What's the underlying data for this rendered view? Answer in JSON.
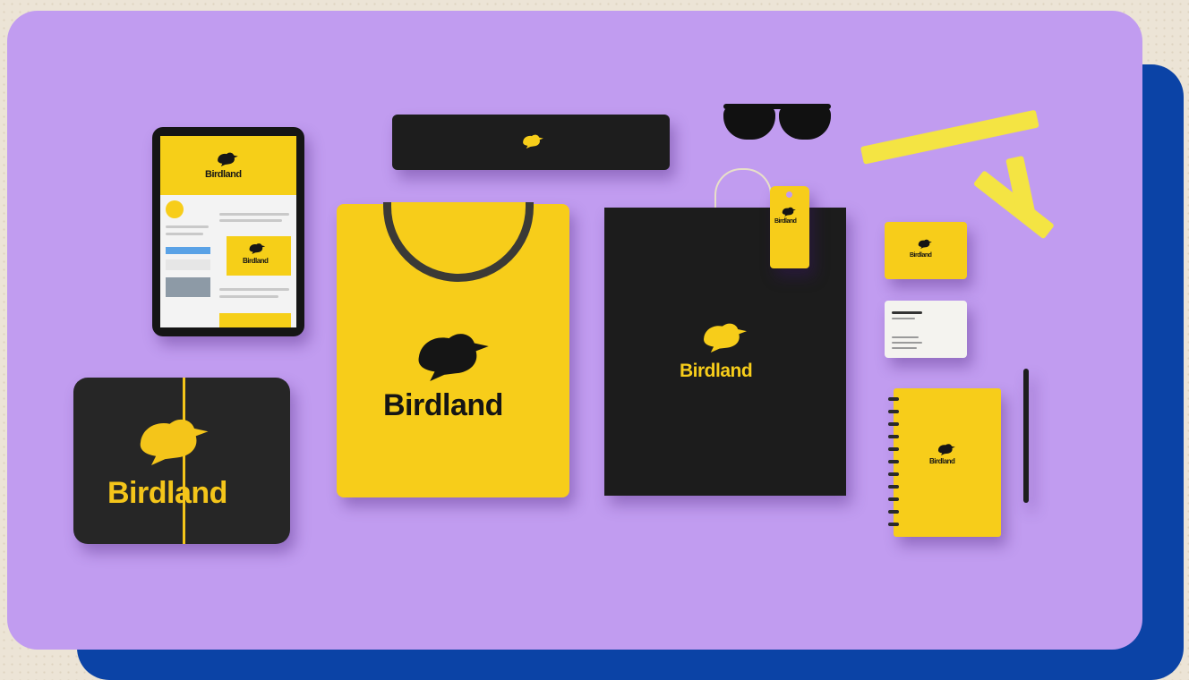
{
  "brand": {
    "name": "Birdland",
    "primary_color": "#f7cd1a",
    "secondary_color": "#1c1c1c",
    "background_color": "#c19cf0",
    "frame_color": "#0b43a6"
  },
  "items": {
    "tablet": {
      "wordmark": "Birdland",
      "banner_wordmark": "Birdland"
    },
    "tube": {
      "icon": "bird-logo-icon"
    },
    "tshirt": {
      "wordmark": "Birdland"
    },
    "rolled_shirt": {
      "wordmark": "Birdland"
    },
    "shopping_bag": {
      "wordmark": "Birdland"
    },
    "hang_tag": {
      "wordmark": "Birdland"
    },
    "business_card_front": {
      "wordmark": "Birdland"
    },
    "notebook": {
      "wordmark": "Birdland"
    }
  }
}
